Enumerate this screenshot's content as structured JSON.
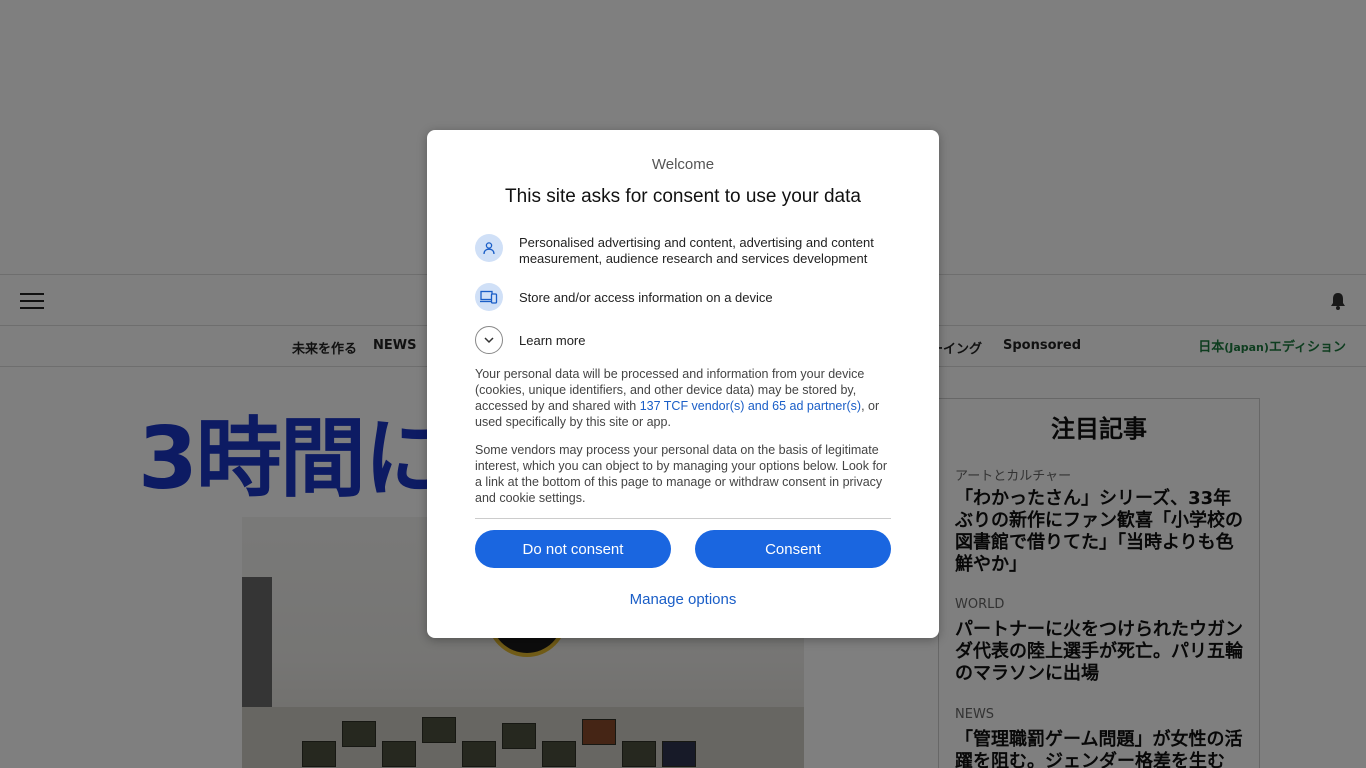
{
  "page": {
    "nav": [
      "未来を作る",
      "NEWS",
      "ーイング",
      "Sponsored"
    ],
    "edition_main": "日本",
    "edition_paren": "(Japan)",
    "edition_suffix": "エディション",
    "headline": "3時間に",
    "sidebar": {
      "title": "注目記事",
      "items": [
        {
          "category": "アートとカルチャー",
          "text": "「わかったさん」シリーズ、33年ぶりの新作にファン歓喜「小学校の図書館で借りてた」「当時よりも色鮮やか」"
        },
        {
          "category": "WORLD",
          "text": "パートナーに火をつけられたウガンダ代表の陸上選手が死亡。パリ五輪のマラソンに出場"
        },
        {
          "category": "NEWS",
          "text": "「管理職罰ゲーム問題」が女性の活躍を阻む。ジェンダー格差を生む"
        }
      ]
    }
  },
  "dialog": {
    "welcome": "Welcome",
    "title": "This site asks for consent to use your data",
    "purposes": [
      {
        "icon": "person-icon",
        "label": "Personalised advertising and content, advertising and content measurement, audience research and services development"
      },
      {
        "icon": "devices-icon",
        "label": "Store and/or access information on a device"
      }
    ],
    "learn_more": "Learn more",
    "para1_before": "Your personal data will be processed and information from your device (cookies, unique identifiers, and other device data) may be stored by, accessed by and shared with ",
    "para1_link": "137 TCF vendor(s) and 65 ad partner(s)",
    "para1_after": ", or used specifically by this site or app.",
    "para2": "Some vendors may process your personal data on the basis of legitimate interest, which you can object to by managing your options below. Look for a link at the bottom of this page to manage or withdraw consent in privacy and cookie settings.",
    "do_not_consent": "Do not consent",
    "consent": "Consent",
    "manage_options": "Manage options"
  },
  "colors": {
    "accent": "#1a66e0",
    "link": "#1a5ec7",
    "headline": "#1a36c7",
    "edition": "#1d7a3f",
    "overlay": "rgba(0,0,0,0.5)"
  }
}
